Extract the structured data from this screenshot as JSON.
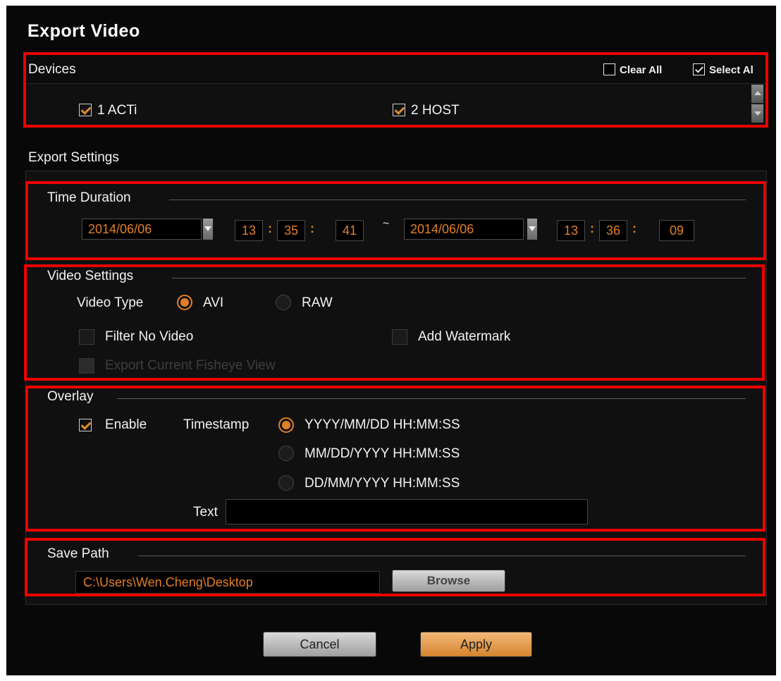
{
  "dialog": {
    "title": "Export Video"
  },
  "devices": {
    "label": "Devices",
    "clear_all": "Clear All",
    "select_all": "Select Al",
    "items": [
      {
        "label": "1 ACTi",
        "checked": true
      },
      {
        "label": "2 HOST",
        "checked": true
      }
    ]
  },
  "export_settings": {
    "label": "Export Settings"
  },
  "time_duration": {
    "label": "Time Duration",
    "start_date": "2014/06/06",
    "start_hh": "13",
    "start_mm": "35",
    "start_ss": "41",
    "separator": "~",
    "end_date": "2014/06/06",
    "end_hh": "13",
    "end_mm": "36",
    "end_ss": "09"
  },
  "video_settings": {
    "label": "Video Settings",
    "video_type_label": "Video Type",
    "avi": "AVI",
    "raw": "RAW",
    "filter_no_video": "Filter No Video",
    "add_watermark": "Add Watermark",
    "fisheye": "Export Current Fisheye View"
  },
  "overlay": {
    "label": "Overlay",
    "enable": "Enable",
    "timestamp_label": "Timestamp",
    "formats": [
      "YYYY/MM/DD HH:MM:SS",
      "MM/DD/YYYY HH:MM:SS",
      "DD/MM/YYYY HH:MM:SS"
    ],
    "text_label": "Text",
    "text_value": ""
  },
  "save_path": {
    "label": "Save Path",
    "path": "C:\\Users\\Wen.Cheng\\Desktop",
    "browse": "Browse"
  },
  "footer": {
    "cancel": "Cancel",
    "apply": "Apply"
  },
  "colors": {
    "accent": "#e07f25",
    "highlight_box": "#ee0000",
    "background": "#080808"
  }
}
